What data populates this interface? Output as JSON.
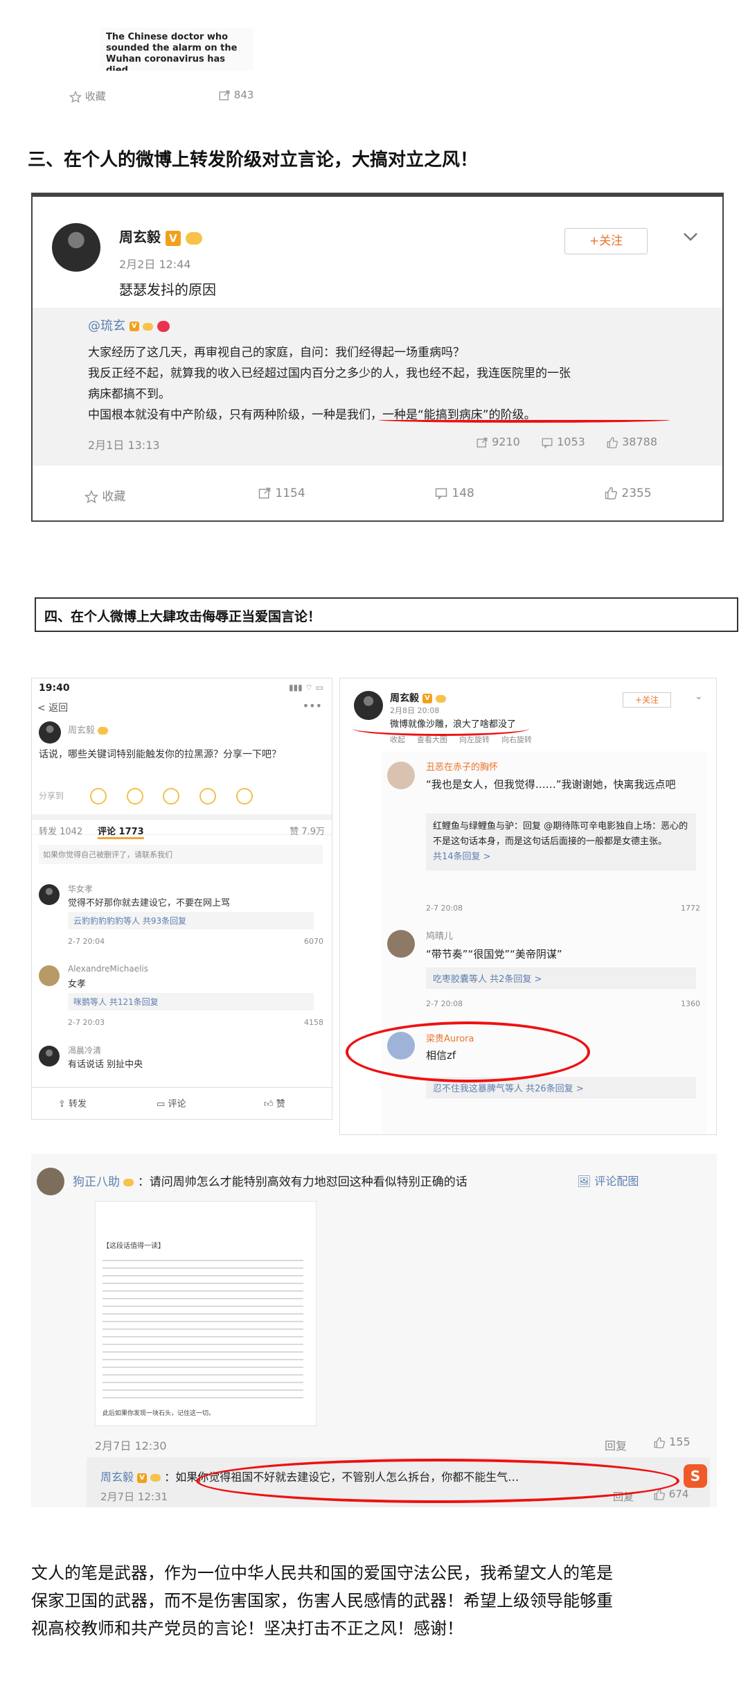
{
  "top_card": {
    "preview_text": "The Chinese doctor who sounded the alarm on the Wuhan coronavirus has died",
    "fav_label": "收藏",
    "repost_count": "843"
  },
  "section3_heading": "三、在个人的微博上转发阶级对立言论，大搞对立之风！",
  "post1": {
    "author": "周玄毅",
    "time": "2月2日 12:44",
    "follow_label": "+关注",
    "text": "瑟瑟发抖的原因",
    "quoted": {
      "author": "@琉玄",
      "line1": "大家经历了这几天，再审视自己的家庭，自问：我们经得起一场重病吗？",
      "line2": "我反正经不起，就算我的收入已经超过国内百分之多少的人，我也经不起，我连医院里的一张",
      "line3": "病床都搞不到。",
      "line4": "中国根本就没有中产阶级，只有两种阶级，一种是我们，一种是“能搞到病床”的阶级。",
      "time": "2月1日 13:13",
      "reposts": "9210",
      "comments": "1053",
      "likes": "38788"
    },
    "actions": {
      "fav": "收藏",
      "repost": "1154",
      "comment": "148",
      "like": "2355"
    }
  },
  "section4_heading": "四、在个人微博上大肆攻击侮辱正当爱国言论！",
  "phone_left": {
    "status_time": "19:40",
    "back_label": "返回",
    "author": "周玄毅",
    "post_text": "话说，哪些关键词特别能触发你的拉黑源？分享一下吧？",
    "share_label": "分享到",
    "tab_repost": "转发 1042",
    "tab_comment": "评论 1773",
    "tab_like": "赞 7.9万",
    "notice": "如果你觉得自己被删评了，请联系我们",
    "comments": [
      {
        "name": "华女孝",
        "text": "觉得不好那你就去建设它，不要在网上骂",
        "sub": "云豹豹豹豹豹等人  共93条回复",
        "time": "2-7 20:04",
        "likes": "6070"
      },
      {
        "name": "AlexandreMichaelis",
        "text": "女孝",
        "sub": "咪鹅等人  共121条回复",
        "time": "2-7 20:03",
        "likes": "4158"
      },
      {
        "name": "渴晨冷清",
        "text": "有话说话 别扯中央",
        "sub": "",
        "time": "",
        "likes": ""
      }
    ],
    "bottom": {
      "repost": "转发",
      "comment": "评论",
      "like": "赞"
    }
  },
  "phone_right": {
    "author": "周玄毅",
    "time": "2月8日 20:08",
    "follow_label": "+关注",
    "text": "微博就像沙雕，浪大了啥都没了",
    "actions": [
      "收起",
      "查看大图",
      "向左旋转",
      "向右旋转"
    ],
    "comments": [
      {
        "name": "丑恶在赤子的胸怀",
        "text": "“我也是女人，但我觉得……”我谢谢她，快离我远点吧",
        "quote": "红鲤鱼与绿鲤鱼与驴：回复 @期待陈可辛电影独自上场：恶心的不是这句话本身，而是这句话后面接的一般都是女德主张。",
        "more": "共14条回复 >",
        "time": "2-7 20:08",
        "likes": "1772"
      },
      {
        "name": "鸠晴儿",
        "text": "“带节奏”“很国党”“美帝阴谋”",
        "more": "吃枣胶囊等人  共2条回复 >",
        "time": "2-7 20:08",
        "likes": "1360"
      },
      {
        "name": "梁贵Aurora",
        "text": "相信zf",
        "more": "忍不住我这暴脾气等人  共26条回复 >"
      }
    ]
  },
  "bottom_card": {
    "commenter": "狗正八助",
    "question": "：请问周帅怎么才能特别高效有力地怼回这种看似特别正确的话",
    "comment_with_image": "评论配图",
    "image_title": "【这段话值得一读】",
    "image_footer": "此后如果你发现一块石头，记住这一切。",
    "time1": "2月7日 12:30",
    "reply_label": "回复",
    "likes1": "155",
    "reply_author": "周玄毅",
    "reply_text": "：如果你觉得祖国不好就去建设它，不管别人怎么拆台，你都不能生气…",
    "time2": "2月7日 12:31",
    "likes2": "674"
  },
  "closing": {
    "line1": "文人的笔是武器，作为一位中华人民共和国的爱国守法公民，我希望文人的笔是",
    "line2": "保家卫国的武器，而不是伤害国家，伤害人民感情的武器！希望上级领导能够重",
    "line3": "视高校教师和共产党员的言论！坚决打击不正之风！感谢！"
  },
  "colors": {
    "weibo_orange": "#e9742b",
    "highlight_red": "#e11111",
    "link_blue": "#5c7fb0"
  }
}
